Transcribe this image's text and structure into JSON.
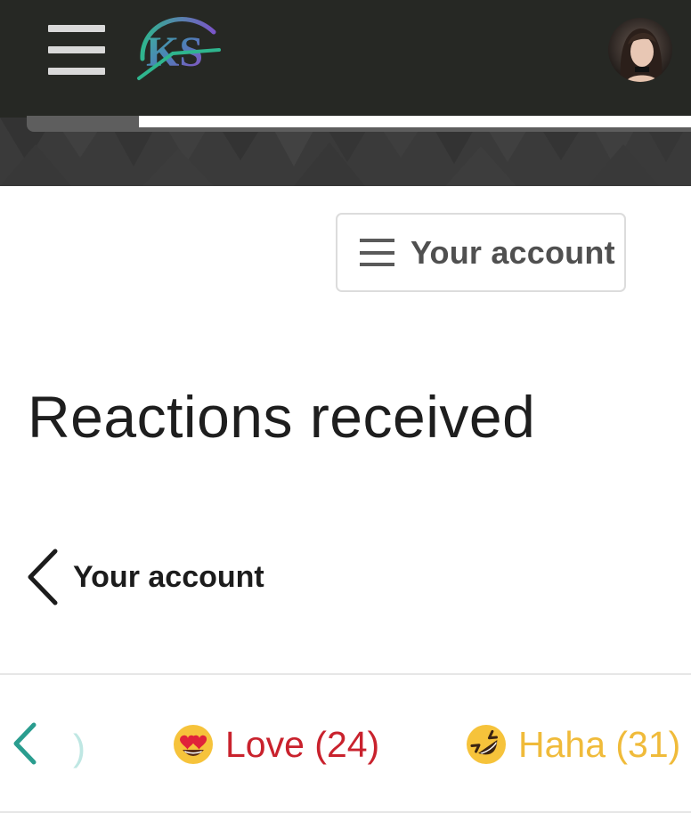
{
  "header": {
    "menu_icon": "hamburger-icon",
    "logo_text": "KS",
    "avatar_icon": "user-avatar"
  },
  "account_button": {
    "label": "Your account",
    "icon": "menu-lines-icon"
  },
  "page": {
    "title": "Reactions received"
  },
  "back_link": {
    "label": "Your account",
    "icon": "chevron-left-icon"
  },
  "tabs": {
    "prev_icon": "chevron-left-icon",
    "partial_text": ")",
    "items": [
      {
        "emoji": "heart-eyes-emoji",
        "label": "Love (24)",
        "color": "#c9222d"
      },
      {
        "emoji": "laughing-emoji",
        "label": "Haha (31)",
        "color": "#f0bb3a"
      }
    ]
  },
  "colors": {
    "topbar": "#262824",
    "accent_teal": "#2a9d8f",
    "love": "#c9222d",
    "haha": "#f0bb3a"
  }
}
